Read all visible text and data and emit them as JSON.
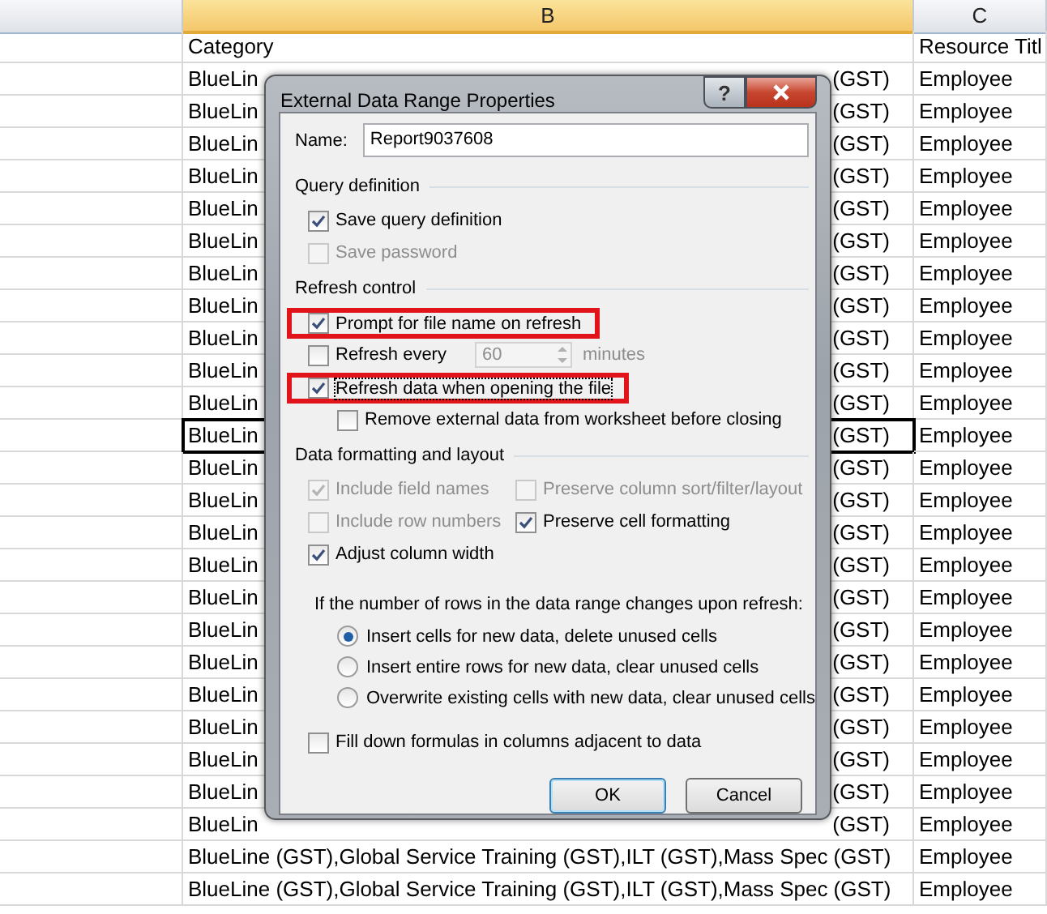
{
  "sheet": {
    "column_headers": [
      {
        "label": "B",
        "selected": true
      },
      {
        "label": "C",
        "selected": false
      }
    ],
    "rows": [
      {
        "kind": "full",
        "category": "Category",
        "resource": "Resource Titl",
        "selected": false
      },
      {
        "kind": "covered",
        "category_start": "BlueLin",
        "category_end": "(GST)",
        "resource": "Employee",
        "selected": false
      },
      {
        "kind": "covered",
        "category_start": "BlueLin",
        "category_end": "(GST)",
        "resource": "Employee",
        "selected": false
      },
      {
        "kind": "covered",
        "category_start": "BlueLin",
        "category_end": "(GST)",
        "resource": "Employee",
        "selected": false
      },
      {
        "kind": "covered",
        "category_start": "BlueLin",
        "category_end": "(GST)",
        "resource": "Employee",
        "selected": false
      },
      {
        "kind": "covered",
        "category_start": "BlueLin",
        "category_end": "(GST)",
        "resource": "Employee",
        "selected": false
      },
      {
        "kind": "covered",
        "category_start": "BlueLin",
        "category_end": "(GST)",
        "resource": "Employee",
        "selected": false
      },
      {
        "kind": "covered",
        "category_start": "BlueLin",
        "category_end": "(GST)",
        "resource": "Employee",
        "selected": false
      },
      {
        "kind": "covered",
        "category_start": "BlueLin",
        "category_end": "(GST)",
        "resource": "Employee",
        "selected": false
      },
      {
        "kind": "covered",
        "category_start": "BlueLin",
        "category_end": "(GST)",
        "resource": "Employee",
        "selected": false
      },
      {
        "kind": "covered",
        "category_start": "BlueLin",
        "category_end": "(GST)",
        "resource": "Employee",
        "selected": false
      },
      {
        "kind": "covered",
        "category_start": "BlueLin",
        "category_end": "(GST)",
        "resource": "Employee",
        "selected": false
      },
      {
        "kind": "covered",
        "category_start": "BlueLin",
        "category_end": "(GST)",
        "resource": "Employee",
        "selected": true
      },
      {
        "kind": "covered",
        "category_start": "BlueLin",
        "category_end": "(GST)",
        "resource": "Employee",
        "selected": false
      },
      {
        "kind": "covered",
        "category_start": "BlueLin",
        "category_end": "(GST)",
        "resource": "Employee",
        "selected": false
      },
      {
        "kind": "covered",
        "category_start": "BlueLin",
        "category_end": "(GST)",
        "resource": "Employee",
        "selected": false
      },
      {
        "kind": "covered",
        "category_start": "BlueLin",
        "category_end": "(GST)",
        "resource": "Employee",
        "selected": false
      },
      {
        "kind": "covered",
        "category_start": "BlueLin",
        "category_end": "(GST)",
        "resource": "Employee",
        "selected": false
      },
      {
        "kind": "covered",
        "category_start": "BlueLin",
        "category_end": "(GST)",
        "resource": "Employee",
        "selected": false
      },
      {
        "kind": "covered",
        "category_start": "BlueLin",
        "category_end": "(GST)",
        "resource": "Employee",
        "selected": false
      },
      {
        "kind": "covered",
        "category_start": "BlueLin",
        "category_end": "(GST)",
        "resource": "Employee",
        "selected": false
      },
      {
        "kind": "covered",
        "category_start": "BlueLin",
        "category_end": "(GST)",
        "resource": "Employee",
        "selected": false
      },
      {
        "kind": "covered",
        "category_start": "BlueLin",
        "category_end": "(GST)",
        "resource": "Employee",
        "selected": false
      },
      {
        "kind": "covered",
        "category_start": "BlueLin",
        "category_end": "(GST)",
        "resource": "Employee",
        "selected": false
      },
      {
        "kind": "covered",
        "category_start": "BlueLin",
        "category_end": "(GST)",
        "resource": "Employee",
        "selected": false
      },
      {
        "kind": "full",
        "category": "BlueLine (GST),Global Service Training (GST),ILT (GST),Mass Spec (GST)",
        "resource": "Employee",
        "selected": false
      },
      {
        "kind": "full",
        "category": "BlueLine (GST),Global Service Training (GST),ILT (GST),Mass Spec (GST)",
        "resource": "Employee",
        "selected": false
      }
    ]
  },
  "dialog": {
    "title": "External Data Range Properties",
    "help": "?",
    "name": {
      "label": "Name:",
      "value": "Report9037608"
    },
    "sections": [
      {
        "title": "Query definition",
        "kind": "list",
        "options": [
          {
            "kind": "checkbox",
            "label": "Save query definition",
            "checked": true,
            "disabled": false,
            "indented": false,
            "highlighted": false,
            "focused": false
          },
          {
            "kind": "checkbox",
            "label": "Save password",
            "checked": false,
            "disabled": true,
            "indented": false,
            "highlighted": false,
            "focused": false
          }
        ]
      },
      {
        "title": "Refresh control",
        "kind": "list",
        "options": [
          {
            "kind": "checkbox",
            "label": "Prompt for file name on refresh",
            "checked": true,
            "disabled": false,
            "indented": false,
            "highlighted": true,
            "focused": false
          },
          {
            "kind": "interval",
            "label": "Refresh every",
            "checked": false,
            "disabled": false,
            "indented": false,
            "highlighted": false,
            "focused": false,
            "value": "60",
            "unit": "minutes"
          },
          {
            "kind": "checkbox",
            "label": "Refresh data when opening the file",
            "checked": true,
            "disabled": false,
            "indented": false,
            "highlighted": true,
            "focused": true
          },
          {
            "kind": "checkbox",
            "label": "Remove external data from worksheet before closing",
            "checked": false,
            "disabled": false,
            "indented": true,
            "highlighted": false,
            "focused": false
          }
        ]
      },
      {
        "title": "Data formatting and layout",
        "kind": "grid",
        "options": [
          {
            "kind": "checkbox",
            "label": "Include field names",
            "checked": true,
            "disabled": true,
            "indented": false,
            "highlighted": false,
            "focused": false
          },
          {
            "kind": "checkbox",
            "label": "Preserve column sort/filter/layout",
            "checked": false,
            "disabled": true,
            "indented": false,
            "highlighted": false,
            "focused": false
          },
          {
            "kind": "checkbox",
            "label": "Include row numbers",
            "checked": false,
            "disabled": true,
            "indented": false,
            "highlighted": false,
            "focused": false
          },
          {
            "kind": "checkbox",
            "label": "Preserve cell formatting",
            "checked": true,
            "disabled": false,
            "indented": false,
            "highlighted": false,
            "focused": false
          },
          {
            "kind": "checkbox",
            "label": "Adjust column width",
            "checked": true,
            "disabled": false,
            "indented": false,
            "highlighted": false,
            "focused": false
          }
        ]
      }
    ],
    "row_change": {
      "prompt": "If the number of rows in the data range changes upon refresh:",
      "choices": [
        {
          "label": "Insert cells for new data, delete unused cells",
          "selected": true
        },
        {
          "label": "Insert entire rows for new data, clear unused cells",
          "selected": false
        },
        {
          "label": "Overwrite existing cells with new data, clear unused cells",
          "selected": false
        }
      ]
    },
    "fill_down": {
      "label": "Fill down formulas in columns adjacent to data",
      "checked": false
    },
    "buttons": [
      {
        "label": "OK",
        "default": true
      },
      {
        "label": "Cancel",
        "default": false
      }
    ]
  }
}
